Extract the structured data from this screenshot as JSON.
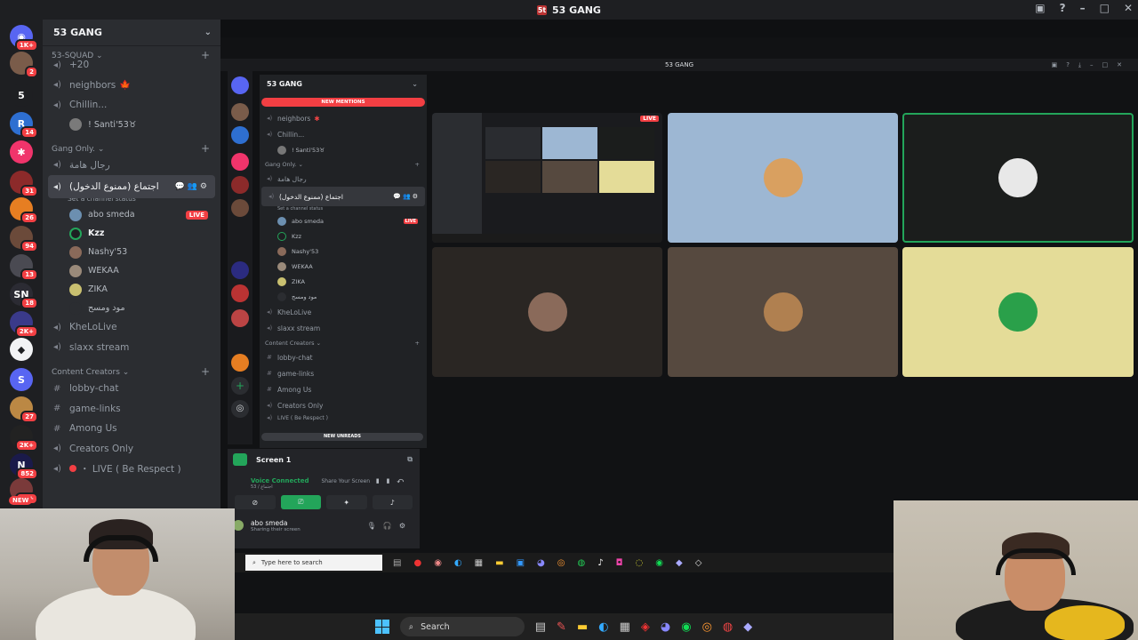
{
  "window": {
    "title": "53 GANG",
    "logo_text": "5t"
  },
  "rail": {
    "servers": [
      {
        "badge": "1K+",
        "color": "#5865f2",
        "glyph": "◉"
      },
      {
        "badge": "2",
        "color": "#7a5c4a",
        "glyph": ""
      },
      {
        "badge": "",
        "color": "#1e1f22",
        "glyph": "5"
      },
      {
        "badge": "14",
        "color": "#2e6fd1",
        "glyph": "R"
      },
      {
        "badge": "",
        "color": "#f0346b",
        "glyph": "✱"
      },
      {
        "badge": "31",
        "color": "#8c2a2a",
        "glyph": ""
      },
      {
        "badge": "26",
        "color": "#e67e22",
        "glyph": ""
      },
      {
        "badge": "94",
        "color": "#6b4a3a",
        "glyph": ""
      },
      {
        "badge": "13",
        "color": "#4a4a52",
        "glyph": ""
      },
      {
        "badge": "18",
        "color": "#2b2b33",
        "glyph": "SN"
      },
      {
        "badge": "2K+",
        "color": "#3a3a8a",
        "glyph": ""
      },
      {
        "badge": "",
        "color": "#f2f3f5",
        "glyph": "◆"
      },
      {
        "badge": "",
        "color": "#5865f2",
        "glyph": "S"
      },
      {
        "badge": "27",
        "color": "#b84",
        "glyph": ""
      },
      {
        "badge": "2K+",
        "color": "#222",
        "glyph": ""
      },
      {
        "badge": "852",
        "color": "#1a1a4a",
        "glyph": "N"
      },
      {
        "badge": "1K+",
        "color": "#7a3a3a",
        "glyph": ""
      }
    ],
    "new_label": "NEW"
  },
  "sidebar": {
    "server_name": "53 GANG",
    "squad_category": "53-SQUAD",
    "items_top": [
      {
        "label": "+20",
        "type": "voice"
      },
      {
        "label": "neighbors",
        "type": "voice",
        "emoji": "🍁"
      },
      {
        "label": "Chillin...",
        "type": "voice"
      }
    ],
    "chillin_user": "! Santi'53♉",
    "gang_category": "Gang Only.",
    "gang_first": "رجال هامة",
    "active_channel": "اجتماع (ممنوع الدخول)",
    "active_status": "Set a channel status",
    "voice_users": [
      {
        "name": "abo smeda",
        "live": "LIVE",
        "color": "#6c8fb0"
      },
      {
        "name": "Kzz",
        "live": "",
        "color": "#1e1f22"
      },
      {
        "name": "Nashy'53",
        "live": "",
        "color": "#8a6a5a"
      },
      {
        "name": "WEKAA",
        "live": "",
        "color": "#9a8a7a"
      },
      {
        "name": "ZIKA",
        "live": "",
        "color": "#c9c070"
      },
      {
        "name": "مود ومسح",
        "live": "",
        "color": "#2b2d31"
      }
    ],
    "items_mid": [
      {
        "label": "KheLoLive",
        "type": "voice"
      },
      {
        "label": "slaxx stream",
        "type": "voice"
      }
    ],
    "creators_category": "Content Creators",
    "text_channels": [
      "lobby-chat",
      "game-links",
      "Among Us",
      "Creators Only"
    ],
    "live_channel": "・ LIVE ( Be Respect )"
  },
  "stream": {
    "inner_title": "53 GANG",
    "mini": {
      "server_name": "53 GANG",
      "new_mentions": "NEW MENTIONS",
      "channels": [
        "neighbors",
        "Chillin..."
      ],
      "santi": "! Santi'53♉",
      "gang_category": "Gang Only.",
      "gang_first": "رجال هامة",
      "active": "اجتماع (ممنوع الدخول)",
      "active_status": "Set a channel status",
      "users": [
        "abo smeda",
        "Kzz",
        "Nashy'53",
        "WEKAA",
        "ZIKA",
        "مود ومسح"
      ],
      "live": "LIVE",
      "more": [
        "KheLoLive",
        "slaxx stream"
      ],
      "creators_category": "Content Creators",
      "text": [
        "lobby-chat",
        "game-links",
        "Among Us",
        "Creators Only"
      ],
      "new_unreads": "NEW UNREADS",
      "live_channel": "LIVE ( Be Respect )"
    },
    "panel": {
      "screen_label": "Screen 1",
      "voice_status": "Voice Connected",
      "voice_sub": "53 / اجتماع",
      "share_hint": "Share Your Screen",
      "me_name": "abo smeda",
      "me_status": "Sharing their screen"
    },
    "tiles": [
      {
        "kind": "screen",
        "color": "#1a1b1e",
        "live": "LIVE"
      },
      {
        "kind": "avatar",
        "color": "#9db7d3",
        "avatar": "#d9a060"
      },
      {
        "kind": "avatar",
        "color": "#1b1d1c",
        "avatar": "#e8e8e8"
      },
      {
        "kind": "avatar",
        "color": "#2a2623",
        "avatar": "#8a6a5a"
      },
      {
        "kind": "avatar",
        "color": "#56493f",
        "avatar": "#b08050"
      },
      {
        "kind": "avatar",
        "color": "#e4dc98",
        "avatar": "#2aa04a"
      }
    ],
    "inner_search": "Type here to search"
  },
  "taskbar": {
    "search_label": "Search"
  },
  "colors": {
    "accent": "#5865f2",
    "live": "#f23f43",
    "green": "#23a55a"
  }
}
